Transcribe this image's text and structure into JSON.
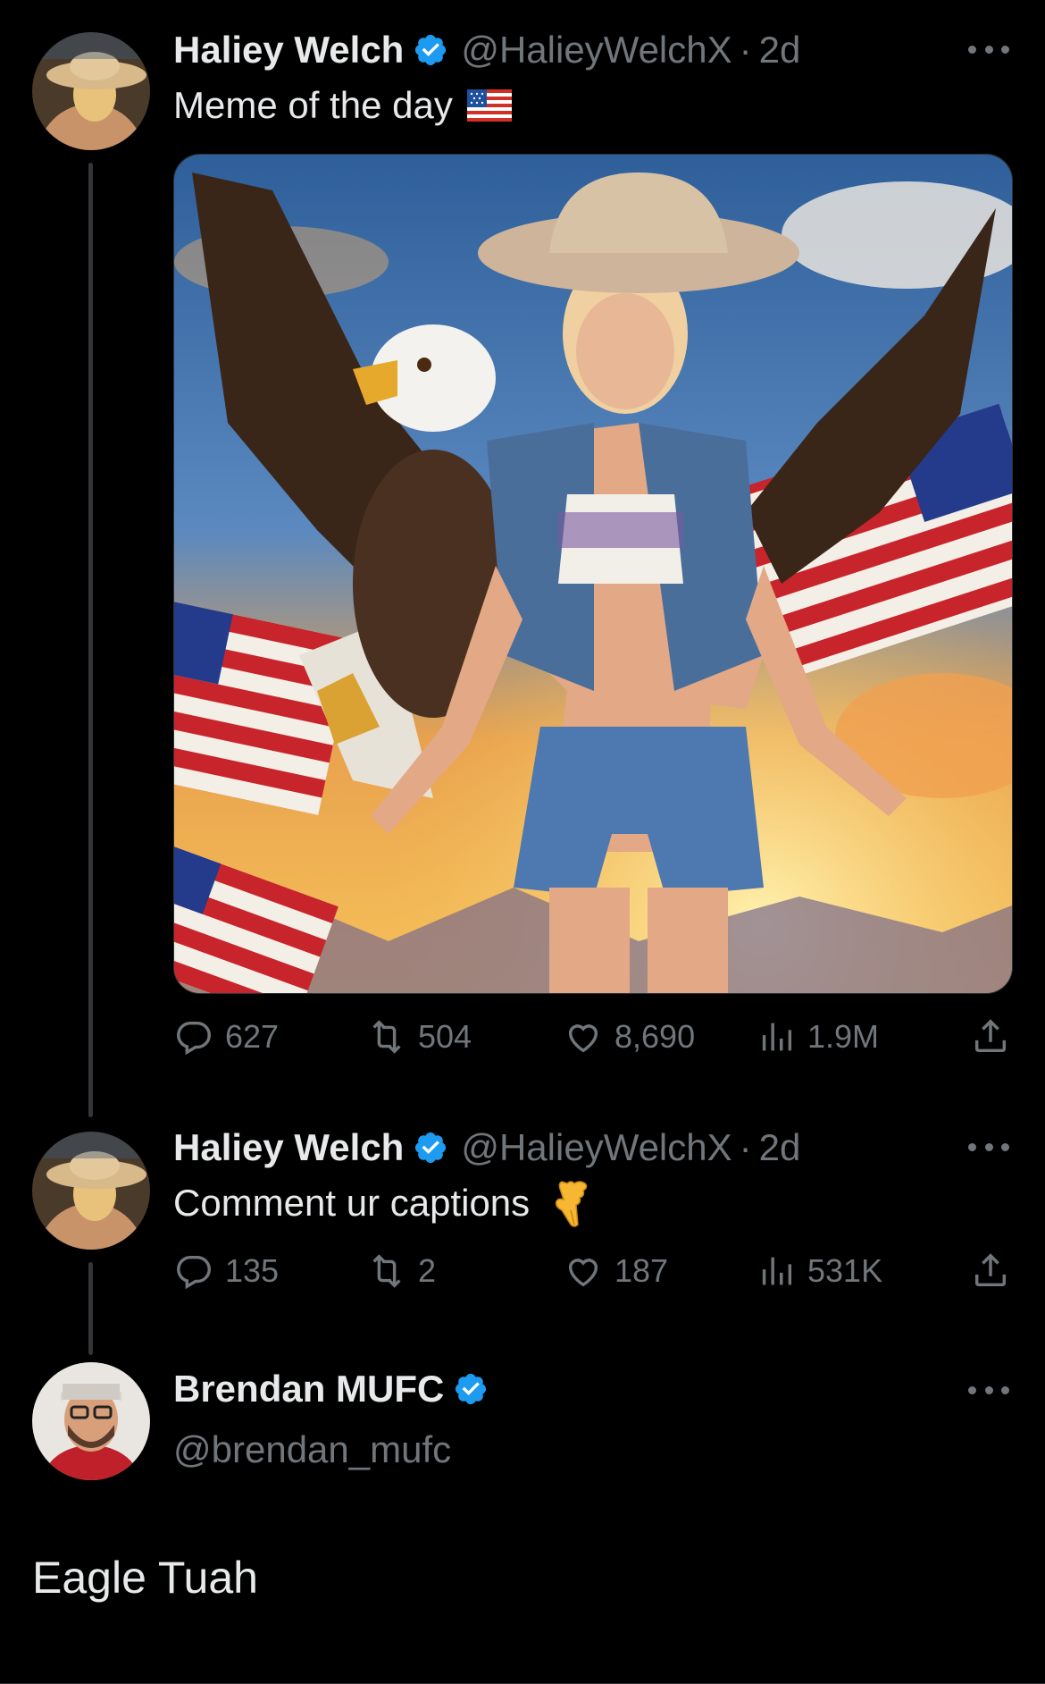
{
  "tweets": [
    {
      "display_name": "Haliey Welch",
      "handle": "@HalieyWelchX",
      "separator": "·",
      "time": "2d",
      "text": "Meme of the day",
      "emoji": "flag-us-icon",
      "stats": {
        "replies": "627",
        "reposts": "504",
        "likes": "8,690",
        "views": "1.9M"
      }
    },
    {
      "display_name": "Haliey Welch",
      "handle": "@HalieyWelchX",
      "separator": "·",
      "time": "2d",
      "text": "Comment ur captions",
      "emoji": "pointing-down-hand-icon",
      "stats": {
        "replies": "135",
        "reposts": "2",
        "likes": "187",
        "views": "531K"
      }
    }
  ],
  "reply": {
    "display_name": "Brendan MUFC",
    "handle": "@brendan_mufc",
    "text": "Eagle Tuah"
  },
  "colors": {
    "background": "#000000",
    "text_primary": "#e7e9ea",
    "text_secondary": "#71767b",
    "verified": "#1d9bf0"
  }
}
